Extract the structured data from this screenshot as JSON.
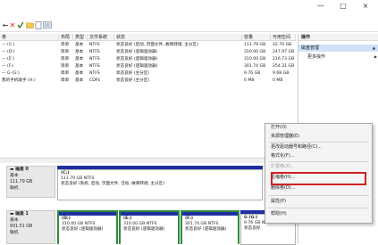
{
  "window": {
    "minimize": "—",
    "maximize": "□",
    "close": "×"
  },
  "toolbar": {
    "back": "←",
    "forward": "→"
  },
  "table": {
    "headers": [
      "卷",
      "布局",
      "类型",
      "文件系统",
      "状态",
      "容量",
      "可用空间",
      "%"
    ],
    "rows": [
      {
        "vol": "— (C:)",
        "layout": "简单",
        "type": "基本",
        "fs": "NTFS",
        "status": "状态良好 (启动, 页面文件, 故障转储, 主分区)",
        "cap": "111.79 GB",
        "free": "42.70 GB",
        "pct": "38 %"
      },
      {
        "vol": "— (D:)",
        "layout": "简单",
        "type": "基本",
        "fs": "NTFS",
        "status": "状态良好 (逻辑驱动器)",
        "cap": "310.00 GB",
        "free": "247.97 GB",
        "pct": "80 %"
      },
      {
        "vol": "— (E:)",
        "layout": "简单",
        "type": "基本",
        "fs": "NTFS",
        "status": "状态良好 (逻辑驱动器)",
        "cap": "310.00 GB",
        "free": "216.73 GB",
        "pct": "70 %"
      },
      {
        "vol": "— (F:)",
        "layout": "简单",
        "type": "基本",
        "fs": "NTFS",
        "status": "状态良好 (逻辑驱动器)",
        "cap": "301.74 GB",
        "free": "254.31 GB",
        "pct": "84 %"
      },
      {
        "vol": "— G (G:)",
        "layout": "简单",
        "type": "基本",
        "fs": "NTFS",
        "status": "状态良好 (主分区)",
        "cap": "9.76 GB",
        "free": "9.68 GB",
        "pct": "99 %"
      },
      {
        "vol": "我的手机助手 (H:)",
        "layout": "简单",
        "type": "基本",
        "fs": "CDFS",
        "status": "状态良好 (主分区)",
        "cap": "6 MB",
        "free": "0 MB",
        "pct": "0 %"
      }
    ]
  },
  "actions": {
    "header": "操作",
    "selected": "磁盘管理",
    "more": "更多操作",
    "arrow_up": "▲",
    "arrow_right": "▶"
  },
  "disks": [
    {
      "name": "磁盘 0",
      "type": "基本",
      "size": "111.79 GB",
      "state": "联机"
    },
    {
      "name": "磁盘 1",
      "type": "基本",
      "size": "931.51 GB",
      "state": "联机"
    }
  ],
  "disk0_part": {
    "name": "(C:)",
    "size": "111.79 GB NTFS",
    "status": "状态良好 (系统, 启动, 页面文件, 活动, 故障转储, 主分区)"
  },
  "disk1_parts": [
    {
      "name": "(D:)",
      "size": "310.00 GB NTFS",
      "status": "状态良好 (逻辑驱动器)"
    },
    {
      "name": "(E:)",
      "size": "310.00 GB NTFS",
      "status": "状态良好 (逻辑驱动器)"
    },
    {
      "name": "(F:)",
      "size": "301.74 GB NTFS",
      "status": "状态良好 (逻辑驱动器)"
    },
    {
      "name": "G (G:)",
      "size": "9.76 GB NTFS",
      "status": "状态良好"
    }
  ],
  "context_menu": {
    "open": "打开(O)",
    "explorer": "资源管理器(E)",
    "change_letter": "更改驱动器号和路径(C)...",
    "format": "格式化(F)...",
    "extend": "扩展卷(X)...",
    "shrink": "压缩卷(H)...",
    "delete": "删除卷(D)...",
    "properties": "属性(P)",
    "help": "帮助(H)"
  },
  "colors": {
    "primary_partition": "#1f2fa0",
    "logical_drive": "#2e8b3d",
    "highlight_box": "#d42020",
    "action_selected": "#cfe2f7"
  }
}
